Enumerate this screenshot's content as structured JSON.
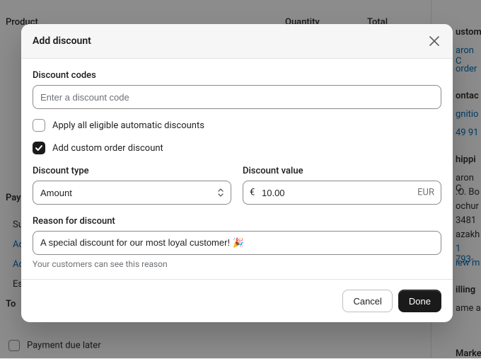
{
  "background": {
    "col_product": "Product",
    "col_quantity": "Quantity",
    "col_total": "Total",
    "payment_heading": "Paym",
    "subtotal": "Su",
    "add_discount": "Ad",
    "add_shipping": "Ad",
    "est_tax": "Es",
    "total_label": "To",
    "payment_due_later": "Payment due later",
    "right": {
      "customer": "ustom",
      "customer_name": "aron C",
      "orders": "order",
      "contact": "ontac",
      "contact_name": "gnitio",
      "phone": "49 91",
      "shipping": "hippi",
      "ship_name": "aron C",
      "ship_l1": ".O. Bo",
      "ship_l2": "ochur",
      "ship_l3": "3481",
      "ship_l4": "azakh",
      "ship_phone": "1 793-",
      "view_map": "iew m",
      "billing": "illing",
      "same_as": "ame a",
      "market": "Market"
    }
  },
  "modal": {
    "title": "Add discount",
    "codes_label": "Discount codes",
    "code_placeholder": "Enter a discount code",
    "apply_auto_label": "Apply all eligible automatic discounts",
    "apply_auto_checked": false,
    "custom_label": "Add custom order discount",
    "custom_checked": true,
    "type_label": "Discount type",
    "type_value": "Amount",
    "value_label": "Discount value",
    "value_currency_symbol": "€",
    "value_amount": "10.00",
    "value_currency_code": "EUR",
    "reason_label": "Reason for discount",
    "reason_value": "A special discount for our most loyal customer! 🎉",
    "reason_helper": "Your customers can see this reason",
    "cancel": "Cancel",
    "done": "Done"
  }
}
